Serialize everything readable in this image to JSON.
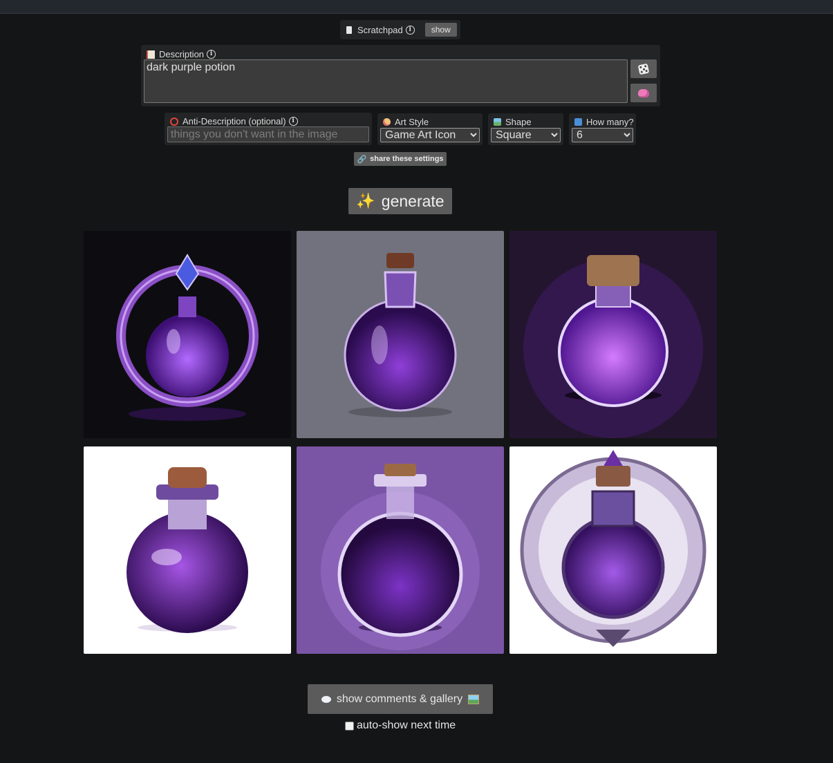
{
  "scratchpad": {
    "label": "Scratchpad",
    "show_label": "show"
  },
  "description": {
    "label": "Description",
    "value": "dark purple potion"
  },
  "anti_description": {
    "label": "Anti-Description (optional)",
    "placeholder": "things you don't want in the image"
  },
  "art_style": {
    "label": "Art Style",
    "selected": "Game Art Icon"
  },
  "shape": {
    "label": "Shape",
    "selected": "Square"
  },
  "how_many": {
    "label": "How many?",
    "selected": "6"
  },
  "share": {
    "label": "share these settings"
  },
  "generate": {
    "label": "generate"
  },
  "gallery": {
    "comments_button": "show comments & gallery",
    "auto_show_label": "auto-show next time",
    "auto_show_checked": false
  },
  "images": [
    {
      "background": "#0d0d11",
      "theme": "purple potion in ring frame"
    },
    {
      "background": "#72727e",
      "theme": "purple potion flask"
    },
    {
      "background": "#24152f",
      "theme": "glowing purple potion flask"
    },
    {
      "background": "#ffffff",
      "theme": "purple potion bottle"
    },
    {
      "background": "#7a55a5",
      "theme": "purple potion flask"
    },
    {
      "background": "#ffffff",
      "theme": "purple potion shield emblem"
    }
  ]
}
